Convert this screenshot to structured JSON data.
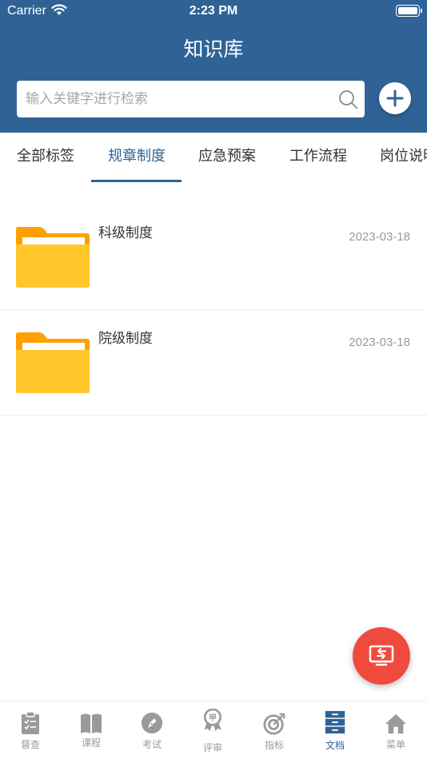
{
  "status_bar": {
    "carrier": "Carrier",
    "time": "2:23 PM"
  },
  "header": {
    "title": "知识库"
  },
  "search": {
    "placeholder": "输入关键字进行检索",
    "value": ""
  },
  "tabs": [
    {
      "label": "全部标签",
      "active": false
    },
    {
      "label": "规章制度",
      "active": true
    },
    {
      "label": "应急预案",
      "active": false
    },
    {
      "label": "工作流程",
      "active": false
    },
    {
      "label": "岗位说明",
      "active": false
    }
  ],
  "documents": [
    {
      "name": "科级制度",
      "date": "2023-03-18",
      "icon": "folder-icon"
    },
    {
      "name": "院级制度",
      "date": "2023-03-18",
      "icon": "folder-icon"
    }
  ],
  "tabbar": [
    {
      "label": "督查",
      "icon": "checklist-icon",
      "active": false
    },
    {
      "label": "课程",
      "icon": "book-icon",
      "active": false
    },
    {
      "label": "考试",
      "icon": "pen-icon",
      "active": false
    },
    {
      "label": "评审",
      "icon": "award-icon",
      "active": false
    },
    {
      "label": "指标",
      "icon": "target-icon",
      "active": false
    },
    {
      "label": "文档",
      "icon": "file-cabinet-icon",
      "active": true
    },
    {
      "label": "菜单",
      "icon": "home-icon",
      "active": false
    }
  ],
  "colors": {
    "primary": "#2f6396",
    "fab": "#f04a3e",
    "folder": "#ffc72c",
    "folder_back": "#ffa000",
    "inactive": "#9a9a9a"
  }
}
